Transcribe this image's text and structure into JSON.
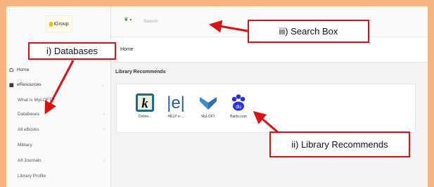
{
  "sidebar": {
    "logo": "iGroup",
    "items": [
      {
        "label": "Home"
      },
      {
        "label": "eResources"
      },
      {
        "label": "What is MyLOFT?"
      },
      {
        "label": "Databases"
      },
      {
        "label": "All eBooks"
      },
      {
        "label": "Military"
      },
      {
        "label": "All Journals"
      },
      {
        "label": "Library Profile"
      }
    ]
  },
  "search": {
    "placeholder": "Search"
  },
  "breadcrumb": "Home",
  "section_title": "Library Recommends",
  "recommends": [
    {
      "caption": "Online..."
    },
    {
      "caption": "HELP e-..."
    },
    {
      "caption": "MyLOFT"
    },
    {
      "caption": "Baidu.com"
    }
  ],
  "callouts": {
    "databases": "i) Databases",
    "search_box": "iii) Search Box",
    "library_recommends": "ii) Library Recommends"
  },
  "colors": {
    "annotation": "#dd1111",
    "frame": "#f5b481"
  }
}
